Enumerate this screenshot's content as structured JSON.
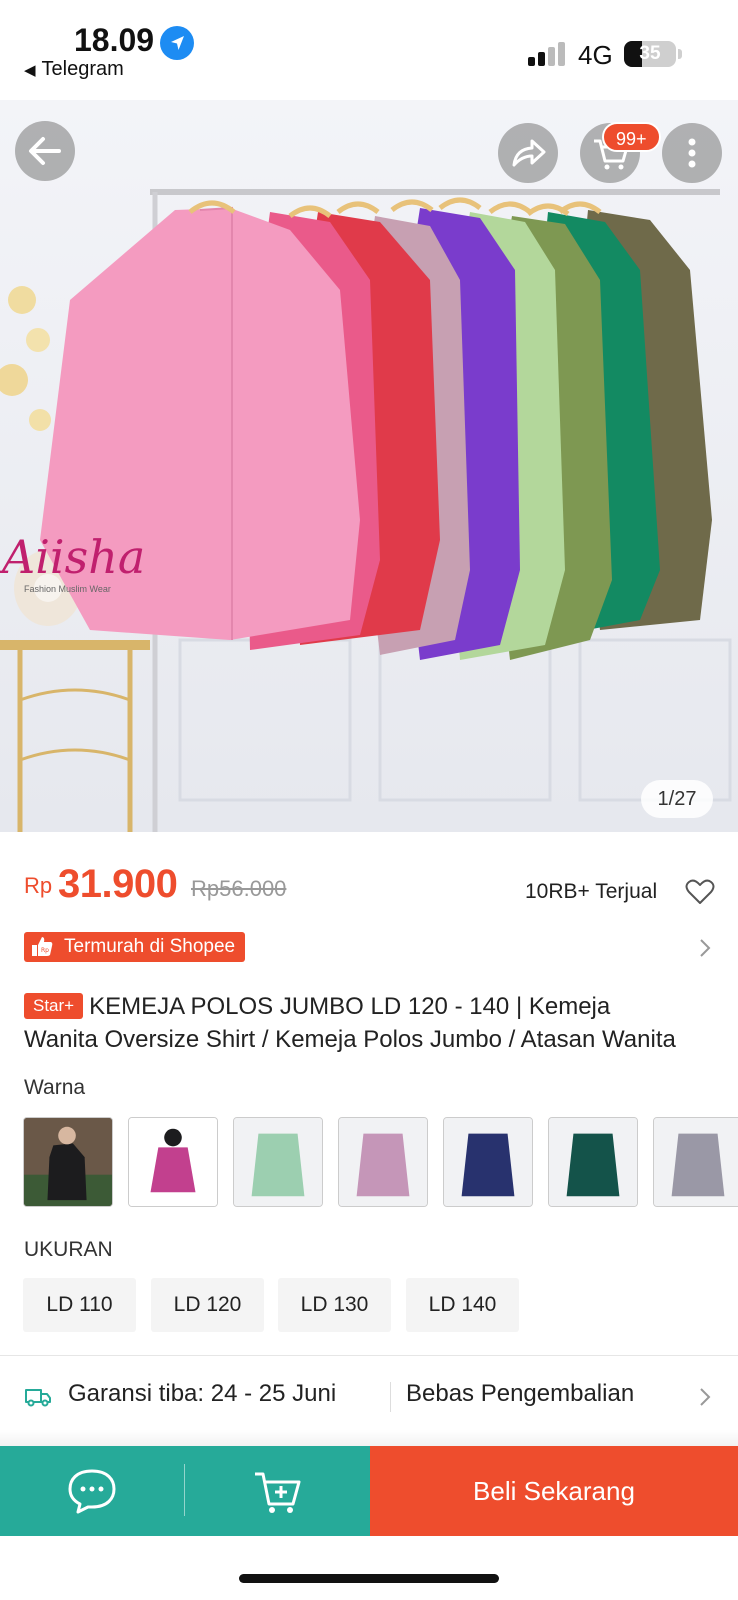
{
  "status_bar": {
    "time": "18.09",
    "back_app": "Telegram",
    "network": "4G",
    "battery": "35",
    "battery_fraction": 0.35
  },
  "header": {
    "cart_badge": "99+",
    "icons": [
      "back-arrow-icon",
      "share-icon",
      "cart-icon",
      "more-vertical-icon"
    ]
  },
  "gallery": {
    "brand_logo": "Aiisha",
    "brand_tagline": "Fashion Muslim Wear",
    "counter": "1/27"
  },
  "product": {
    "currency": "Rp",
    "price": "31.900",
    "original_price": "Rp56.000",
    "sold": "10RB+ Terjual",
    "cheapest_badge": "Termurah di Shopee",
    "title_badge": "Star+",
    "title_line1": "KEMEJA POLOS JUMBO LD 120 - 140 | Kemeja",
    "title_line2": "Wanita Oversize Shirt / Kemeja Polos Jumbo / Atasan Wanita"
  },
  "variants": {
    "color_label": "Warna",
    "colors": [
      "#1c1c1e",
      "#c2408e",
      "#9ccfb0",
      "#c596b8",
      "#28326e",
      "#14534a",
      "#9a98a6"
    ],
    "size_label": "UKURAN",
    "sizes": [
      "LD 110",
      "LD 120",
      "LD 130",
      "LD 140"
    ]
  },
  "shipping": {
    "guarantee": "Garansi tiba: 24 - 25 Juni",
    "returns": "Bebas Pengembalian"
  },
  "actions": {
    "buy_now": "Beli Sekarang"
  },
  "colors": {
    "accent": "#ee4d2d",
    "teal": "#26aa99"
  }
}
